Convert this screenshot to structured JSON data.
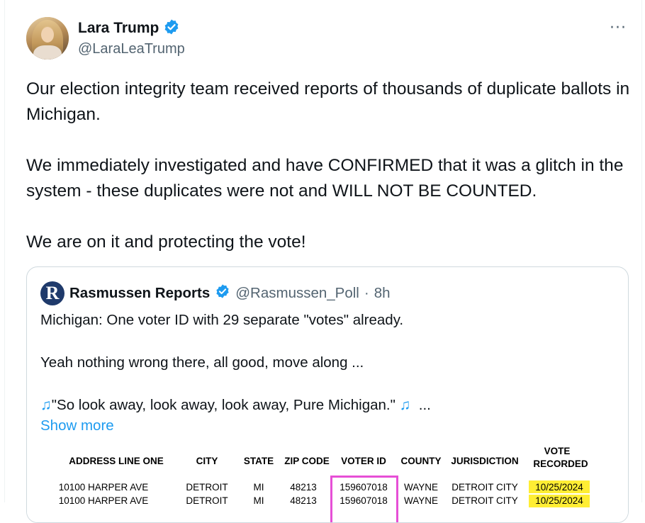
{
  "tweet": {
    "author_name": "Lara Trump",
    "author_handle": "@LaraLeaTrump",
    "more_icon": "···",
    "paragraphs": [
      "Our election integrity team received reports of thousands of duplicate ballots in Michigan.",
      "We immediately investigated and have CONFIRMED that it was a glitch in the system - these duplicates were not and WILL NOT BE COUNTED.",
      "We are on it and protecting the vote!"
    ]
  },
  "quote": {
    "logo_letter": "R",
    "author_name": "Rasmussen Reports",
    "author_handle": "@Rasmussen_Poll",
    "separator": "·",
    "time": "8h",
    "line1": "Michigan: One voter ID with 29 separate \"votes\" already.",
    "line2": "Yeah nothing wrong there, all good, move along ...",
    "line3_text": "\"So look away, look away, look away, Pure Michigan.\"",
    "line3_ellipsis": "...",
    "music_icon": "♫",
    "show_more": "Show more"
  },
  "table": {
    "headers": [
      "ADDRESS LINE ONE",
      "CITY",
      "STATE",
      "ZIP CODE",
      "VOTER ID",
      "COUNTY",
      "JURISDICTION",
      "VOTE",
      "RECORDED"
    ],
    "rows": [
      [
        "10100 HARPER AVE",
        "DETROIT",
        "MI",
        "48213",
        "159607018",
        "WAYNE",
        "DETROIT CITY",
        "10/25/2024"
      ],
      [
        "10100 HARPER AVE",
        "DETROIT",
        "MI",
        "48213",
        "159607018",
        "WAYNE",
        "DETROIT CITY",
        "10/25/2024"
      ]
    ]
  },
  "colors": {
    "verified_badge": "#1d9bf0",
    "link": "#1d9bf0",
    "highlight_yellow": "#ffee34",
    "voter_id_box": "#e64fd6"
  }
}
